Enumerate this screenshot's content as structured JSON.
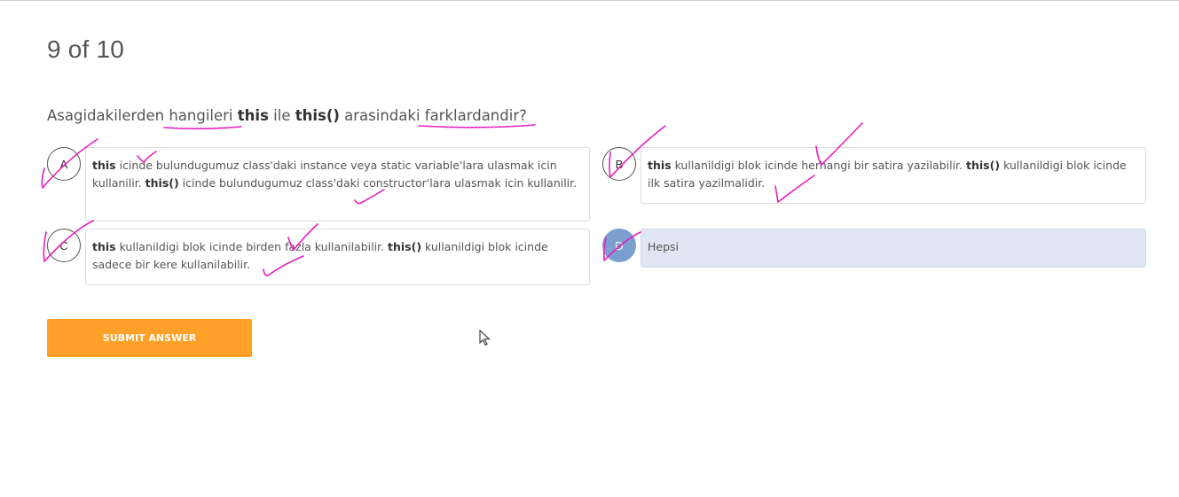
{
  "progress": {
    "text": "9 of 10"
  },
  "question": {
    "part1": "Asagidakilerden hangileri ",
    "bold1": "this",
    "part2": " ile ",
    "bold2": "this()",
    "part3": " arasindaki farklardandir?"
  },
  "options": [
    {
      "letter": "A",
      "b1": "this",
      "t1": " icinde bulundugumuz class'daki instance veya static variable'lara ulasmak icin kullanilir. ",
      "b2": "this()",
      "t2": " icinde bulundugumuz class'daki constructor'lara ulasmak icin kullanilir."
    },
    {
      "letter": "B",
      "b1": "this",
      "t1": " kullanildigi blok icinde herhangi bir satira yazilabilir. ",
      "b2": "this()",
      "t2": " kullanildigi blok icinde ilk satira yazilmalidir."
    },
    {
      "letter": "C",
      "b1": "this",
      "t1": " kullanildigi blok icinde birden fazla kullanilabilir. ",
      "b2": "this()",
      "t2": " kullanildigi blok icinde sadece bir kere kullanilabilir."
    },
    {
      "letter": "D",
      "text": "Hepsi",
      "selected": true
    }
  ],
  "submit": {
    "label": "SUBMIT ANSWER"
  },
  "colors": {
    "accent_orange": "#ffa029",
    "selected_fill": "#e0e6f4",
    "selected_letter": "#7b9fcf",
    "annotation_pink": "#e61ebe"
  },
  "icons": {
    "cursor": "mouse-pointer-icon"
  }
}
